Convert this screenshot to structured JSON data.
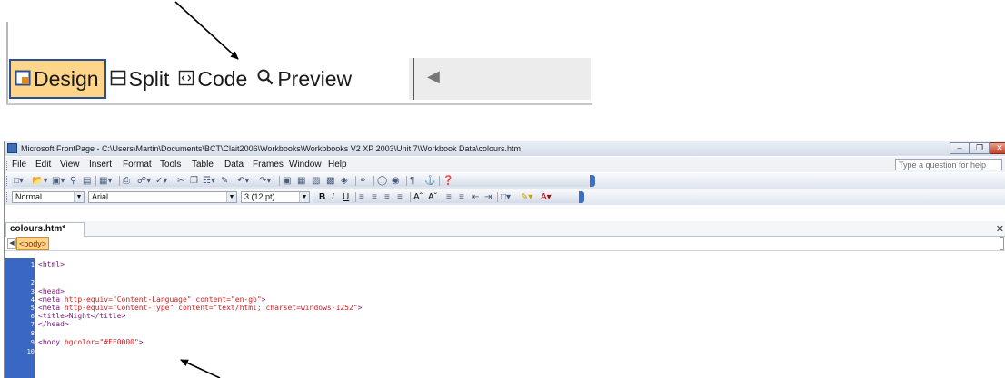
{
  "view_tabs": {
    "items": [
      {
        "label": "Design",
        "icon": "design-icon",
        "active": true
      },
      {
        "label": "Split",
        "icon": "split-icon",
        "active": false
      },
      {
        "label": "Code",
        "icon": "code-icon",
        "active": false
      },
      {
        "label": "Preview",
        "icon": "preview-icon",
        "active": false
      }
    ]
  },
  "window": {
    "title": "Microsoft FrontPage - C:\\Users\\Martin\\Documents\\BCT\\Clait2006\\Workbooks\\Workbbooks V2 XP 2003\\Unit 7\\Workbook Data\\colours.htm",
    "menu": [
      "File",
      "Edit",
      "View",
      "Insert",
      "Format",
      "Tools",
      "Table",
      "Data",
      "Frames",
      "Window",
      "Help"
    ],
    "help_placeholder": "Type a question for help",
    "format": {
      "style": "Normal",
      "font": "Arial",
      "size": "3 (12 pt)"
    },
    "doc_tab": "colours.htm*",
    "tag_selector": "<body>",
    "code_lines": [
      {
        "n": "1",
        "text": "<html>"
      },
      {
        "n": "2",
        "text": ""
      },
      {
        "n": "3",
        "text": "<head>"
      },
      {
        "n": "4",
        "tag": "<meta ",
        "attr": "http-equiv=\"Content-Language\" content=\"en-gb\"",
        "end": ">"
      },
      {
        "n": "5",
        "tag": "<meta ",
        "attr": "http-equiv=\"Content-Type\" content=\"text/html; charset=windows-1252\"",
        "end": ">"
      },
      {
        "n": "6",
        "text": "<title>Night</title>"
      },
      {
        "n": "7",
        "text": "</head>"
      },
      {
        "n": "8",
        "text": ""
      },
      {
        "n": "9",
        "tag": "<body ",
        "attr": "bgcolor=\"#FF0000\"",
        "end": ">"
      },
      {
        "n": "10",
        "text": ""
      }
    ]
  },
  "colors": {
    "gutter": "#3a66c4",
    "active_tab": "#ffd58a",
    "tag_color": "#7a1a7a",
    "attr_color": "#d02020"
  }
}
